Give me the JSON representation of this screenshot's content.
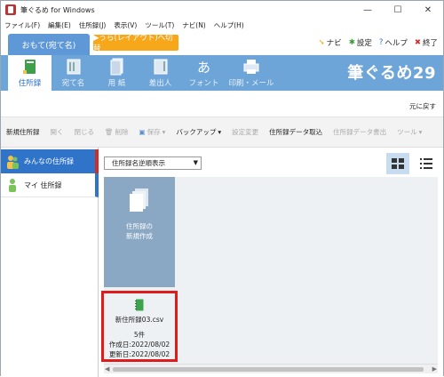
{
  "window": {
    "title": "筆ぐるめ for Windows",
    "minimize": "—",
    "maximize": "☐",
    "close": "✕"
  },
  "menu": [
    "ファイル(F)",
    "編集(E)",
    "住所録(J)",
    "表示(V)",
    "ツール(T)",
    "ナビ(N)",
    "ヘルプ(H)"
  ],
  "mode": {
    "front_tab": "おもて(宛て名)",
    "switch_button": "▶うら(レイアウト)へ切替"
  },
  "topright": {
    "navi": "ナビ",
    "settings": "設定",
    "help": "ヘルプ",
    "exit": "終了"
  },
  "ribbon": {
    "items": [
      "住所録",
      "宛て名",
      "用 紙",
      "差出人",
      "フォント",
      "印刷・メール"
    ],
    "brand": "筆ぐるめ29"
  },
  "back_link": "元に戻す",
  "commands": [
    {
      "label": "新規住所録",
      "enabled": true
    },
    {
      "label": "開く",
      "enabled": false
    },
    {
      "label": "閉じる",
      "enabled": false
    },
    {
      "label": "削除",
      "enabled": false
    },
    {
      "label": "保存",
      "enabled": false
    },
    {
      "label": "バックアップ",
      "enabled": true
    },
    {
      "label": "設定変更",
      "enabled": false
    },
    {
      "label": "住所録データ取込",
      "enabled": true
    },
    {
      "label": "住所録データ書出",
      "enabled": false
    },
    {
      "label": "ツール",
      "enabled": false
    }
  ],
  "sidebar": {
    "items": [
      "みんなの住所録",
      "マイ 住所録"
    ]
  },
  "sort": {
    "selected": "住所録名逆順表示"
  },
  "cards": {
    "new": {
      "line1": "住所録の",
      "line2": "新規作成"
    },
    "csv": {
      "name": "新住所録03.csv",
      "count": "5件",
      "created": "作成日:2022/08/02",
      "updated": "更新日:2022/08/02"
    }
  },
  "colors": {
    "ribbon": "#6ea5d8",
    "accent": "#2f74c8",
    "highlight": "#e01b1b",
    "switch": "#f7a71a"
  }
}
